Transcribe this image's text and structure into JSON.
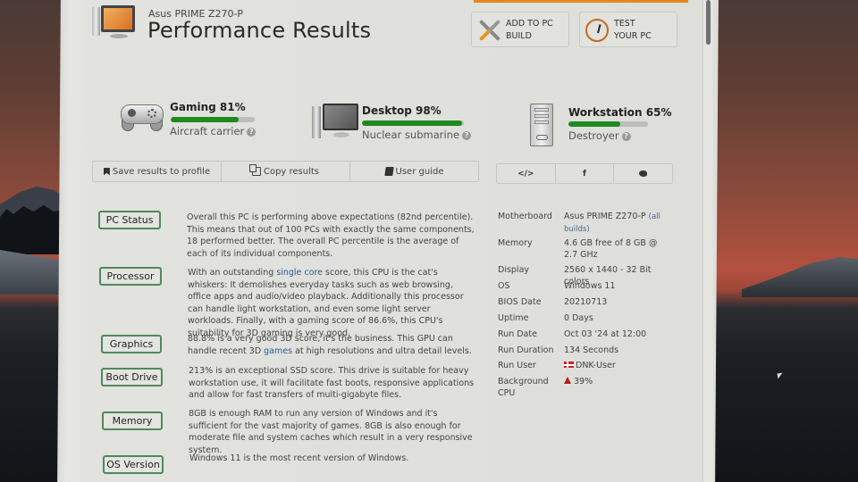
{
  "header": {
    "subtitle": "Asus PRIME Z270-P",
    "title": "Performance Results",
    "buttons": {
      "add_to_build": [
        "ADD TO PC",
        "BUILD"
      ],
      "test_pc": [
        "TEST",
        "YOUR PC"
      ]
    }
  },
  "scores": [
    {
      "name": "Gaming 81%",
      "percent": 81,
      "desc": "Aircraft carrier",
      "icon": "gamepad-icon"
    },
    {
      "name": "Desktop 98%",
      "percent": 98,
      "desc": "Nuclear submarine",
      "icon": "desktop-pc-icon"
    },
    {
      "name": "Workstation 65%",
      "percent": 65,
      "desc": "Destroyer",
      "icon": "server-icon"
    }
  ],
  "colors": {
    "bar_fill": "#1f8a1f",
    "section_border": "#4f8a5a",
    "link": "#2b5d8f",
    "accent": "#e08a1e"
  },
  "actions": {
    "save": "Save results to profile",
    "copy": "Copy results",
    "guide": "User guide"
  },
  "share": {
    "embed": "</>",
    "facebook": "f",
    "twitter": "🐦"
  },
  "sections": [
    {
      "label": "PC Status",
      "text_before": "Overall this PC is performing above expectations (82nd percentile). This means that out of 100 PCs with exactly the same components, 18 performed better. The overall PC percentile is the average of each of its individual components.",
      "link": "",
      "text_after": ""
    },
    {
      "label": "Processor",
      "text_before": "With an outstanding ",
      "link": "single core",
      "text_after": " score, this CPU is the cat's whiskers: It demolishes everyday tasks such as web browsing, office apps and audio/video playback. Additionally this processor can handle light workstation, and even some light server workloads. Finally, with a gaming score of 86.6%, this CPU's suitability for 3D gaming is very good."
    },
    {
      "label": "Graphics",
      "text_before": "88.8% is a very good 3D score, it's the business. This GPU can handle recent 3D ",
      "link": "games",
      "text_after": " at high resolutions and ultra detail levels."
    },
    {
      "label": "Boot Drive",
      "text_before": "213% is an exceptional SSD score. This drive is suitable for heavy workstation use, it will facilitate fast boots, responsive applications and allow for fast transfers of multi-gigabyte files.",
      "link": "",
      "text_after": ""
    },
    {
      "label": "Memory",
      "text_before": "8GB is enough RAM to run any version of Windows and it's sufficient for the vast majority of games. 8GB is also enough for moderate file and system caches which result in a very responsive system.",
      "link": "",
      "text_after": ""
    },
    {
      "label": "OS Version",
      "text_before": "Windows 11 is the most recent version of Windows.",
      "link": "",
      "text_after": ""
    }
  ],
  "specs": [
    {
      "label": "Motherboard",
      "value": "Asus PRIME Z270-P",
      "link": "(all builds)"
    },
    {
      "label": "Memory",
      "value": "4.6 GB free of 8 GB @ 2.7 GHz"
    },
    {
      "label": "Display",
      "value": "2560 x 1440 - 32 Bit colors"
    },
    {
      "label": "OS",
      "value": "Windows 11"
    },
    {
      "label": "BIOS Date",
      "value": "20210713"
    },
    {
      "label": "Uptime",
      "value": "0 Days"
    },
    {
      "label": "Run Date",
      "value": "Oct 03 '24 at 12:00"
    },
    {
      "label": "Run Duration",
      "value": "134 Seconds"
    },
    {
      "label": "Run User",
      "value": "DNK-User",
      "icon": "denmark-flag-icon"
    },
    {
      "label": "Background CPU",
      "value": "39%",
      "icon": "warning-icon"
    }
  ]
}
